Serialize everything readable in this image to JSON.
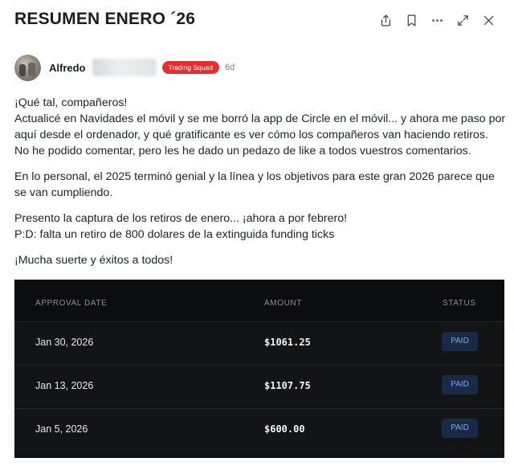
{
  "post": {
    "title": "RESUMEN ENERO ´26",
    "author_name": "Alfredo",
    "badge": "Trading Squad",
    "time_ago": "6d",
    "badge_color": "#e0312e"
  },
  "actions": [
    {
      "icon": "share-icon"
    },
    {
      "icon": "bookmark-icon"
    },
    {
      "icon": "more-icon"
    },
    {
      "icon": "expand-icon"
    },
    {
      "icon": "close-icon"
    }
  ],
  "body": {
    "p1_l1": "¡Qué tal, compañeros!",
    "p1_l2": "Actualicé en Navidades el móvil y se me borró la app de Circle en el móvil... y ahora me paso por",
    "p1_l3": "aquí desde el ordenador, y qué gratificante es ver cómo los compañeros van haciendo retiros.",
    "p1_l4": "No he podido comentar, pero les he dado un pedazo de like a todos vuestros comentarios.",
    "p2_l1": "En lo personal, el 2025 terminó genial y la línea y los objetivos para este gran 2026 parece que",
    "p2_l2": "se van cumpliendo.",
    "p3_l1": "Presento la captura de los retiros de enero... ¡ahora a por febrero!",
    "p3_l2": "P:D: falta un retiro de 800 dolares de la extinguida funding ticks",
    "p4_l1": "¡Mucha suerte y éxitos a todos!"
  },
  "table": {
    "headers": {
      "date": "APPROVAL DATE",
      "amount": "AMOUNT",
      "status": "STATUS"
    },
    "rows": [
      {
        "date": "Jan 30, 2026",
        "amount": "$1061.25",
        "status": "PAID"
      },
      {
        "date": "Jan 13, 2026",
        "amount": "$1107.75",
        "status": "PAID"
      },
      {
        "date": "Jan 5, 2026",
        "amount": "$600.00",
        "status": "PAID"
      }
    ]
  }
}
